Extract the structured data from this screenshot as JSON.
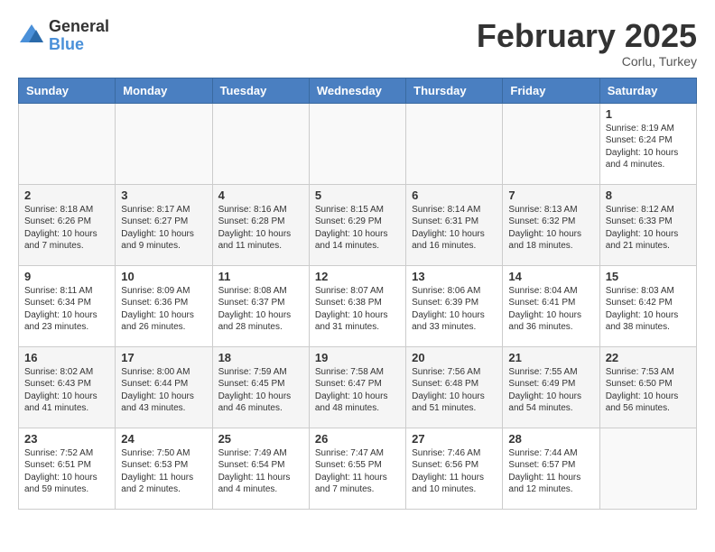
{
  "header": {
    "logo_general": "General",
    "logo_blue": "Blue",
    "month_title": "February 2025",
    "subtitle": "Corlu, Turkey"
  },
  "days_of_week": [
    "Sunday",
    "Monday",
    "Tuesday",
    "Wednesday",
    "Thursday",
    "Friday",
    "Saturday"
  ],
  "weeks": [
    [
      {
        "day": "",
        "info": ""
      },
      {
        "day": "",
        "info": ""
      },
      {
        "day": "",
        "info": ""
      },
      {
        "day": "",
        "info": ""
      },
      {
        "day": "",
        "info": ""
      },
      {
        "day": "",
        "info": ""
      },
      {
        "day": "1",
        "info": "Sunrise: 8:19 AM\nSunset: 6:24 PM\nDaylight: 10 hours\nand 4 minutes."
      }
    ],
    [
      {
        "day": "2",
        "info": "Sunrise: 8:18 AM\nSunset: 6:26 PM\nDaylight: 10 hours\nand 7 minutes."
      },
      {
        "day": "3",
        "info": "Sunrise: 8:17 AM\nSunset: 6:27 PM\nDaylight: 10 hours\nand 9 minutes."
      },
      {
        "day": "4",
        "info": "Sunrise: 8:16 AM\nSunset: 6:28 PM\nDaylight: 10 hours\nand 11 minutes."
      },
      {
        "day": "5",
        "info": "Sunrise: 8:15 AM\nSunset: 6:29 PM\nDaylight: 10 hours\nand 14 minutes."
      },
      {
        "day": "6",
        "info": "Sunrise: 8:14 AM\nSunset: 6:31 PM\nDaylight: 10 hours\nand 16 minutes."
      },
      {
        "day": "7",
        "info": "Sunrise: 8:13 AM\nSunset: 6:32 PM\nDaylight: 10 hours\nand 18 minutes."
      },
      {
        "day": "8",
        "info": "Sunrise: 8:12 AM\nSunset: 6:33 PM\nDaylight: 10 hours\nand 21 minutes."
      }
    ],
    [
      {
        "day": "9",
        "info": "Sunrise: 8:11 AM\nSunset: 6:34 PM\nDaylight: 10 hours\nand 23 minutes."
      },
      {
        "day": "10",
        "info": "Sunrise: 8:09 AM\nSunset: 6:36 PM\nDaylight: 10 hours\nand 26 minutes."
      },
      {
        "day": "11",
        "info": "Sunrise: 8:08 AM\nSunset: 6:37 PM\nDaylight: 10 hours\nand 28 minutes."
      },
      {
        "day": "12",
        "info": "Sunrise: 8:07 AM\nSunset: 6:38 PM\nDaylight: 10 hours\nand 31 minutes."
      },
      {
        "day": "13",
        "info": "Sunrise: 8:06 AM\nSunset: 6:39 PM\nDaylight: 10 hours\nand 33 minutes."
      },
      {
        "day": "14",
        "info": "Sunrise: 8:04 AM\nSunset: 6:41 PM\nDaylight: 10 hours\nand 36 minutes."
      },
      {
        "day": "15",
        "info": "Sunrise: 8:03 AM\nSunset: 6:42 PM\nDaylight: 10 hours\nand 38 minutes."
      }
    ],
    [
      {
        "day": "16",
        "info": "Sunrise: 8:02 AM\nSunset: 6:43 PM\nDaylight: 10 hours\nand 41 minutes."
      },
      {
        "day": "17",
        "info": "Sunrise: 8:00 AM\nSunset: 6:44 PM\nDaylight: 10 hours\nand 43 minutes."
      },
      {
        "day": "18",
        "info": "Sunrise: 7:59 AM\nSunset: 6:45 PM\nDaylight: 10 hours\nand 46 minutes."
      },
      {
        "day": "19",
        "info": "Sunrise: 7:58 AM\nSunset: 6:47 PM\nDaylight: 10 hours\nand 48 minutes."
      },
      {
        "day": "20",
        "info": "Sunrise: 7:56 AM\nSunset: 6:48 PM\nDaylight: 10 hours\nand 51 minutes."
      },
      {
        "day": "21",
        "info": "Sunrise: 7:55 AM\nSunset: 6:49 PM\nDaylight: 10 hours\nand 54 minutes."
      },
      {
        "day": "22",
        "info": "Sunrise: 7:53 AM\nSunset: 6:50 PM\nDaylight: 10 hours\nand 56 minutes."
      }
    ],
    [
      {
        "day": "23",
        "info": "Sunrise: 7:52 AM\nSunset: 6:51 PM\nDaylight: 10 hours\nand 59 minutes."
      },
      {
        "day": "24",
        "info": "Sunrise: 7:50 AM\nSunset: 6:53 PM\nDaylight: 11 hours\nand 2 minutes."
      },
      {
        "day": "25",
        "info": "Sunrise: 7:49 AM\nSunset: 6:54 PM\nDaylight: 11 hours\nand 4 minutes."
      },
      {
        "day": "26",
        "info": "Sunrise: 7:47 AM\nSunset: 6:55 PM\nDaylight: 11 hours\nand 7 minutes."
      },
      {
        "day": "27",
        "info": "Sunrise: 7:46 AM\nSunset: 6:56 PM\nDaylight: 11 hours\nand 10 minutes."
      },
      {
        "day": "28",
        "info": "Sunrise: 7:44 AM\nSunset: 6:57 PM\nDaylight: 11 hours\nand 12 minutes."
      },
      {
        "day": "",
        "info": ""
      }
    ]
  ]
}
